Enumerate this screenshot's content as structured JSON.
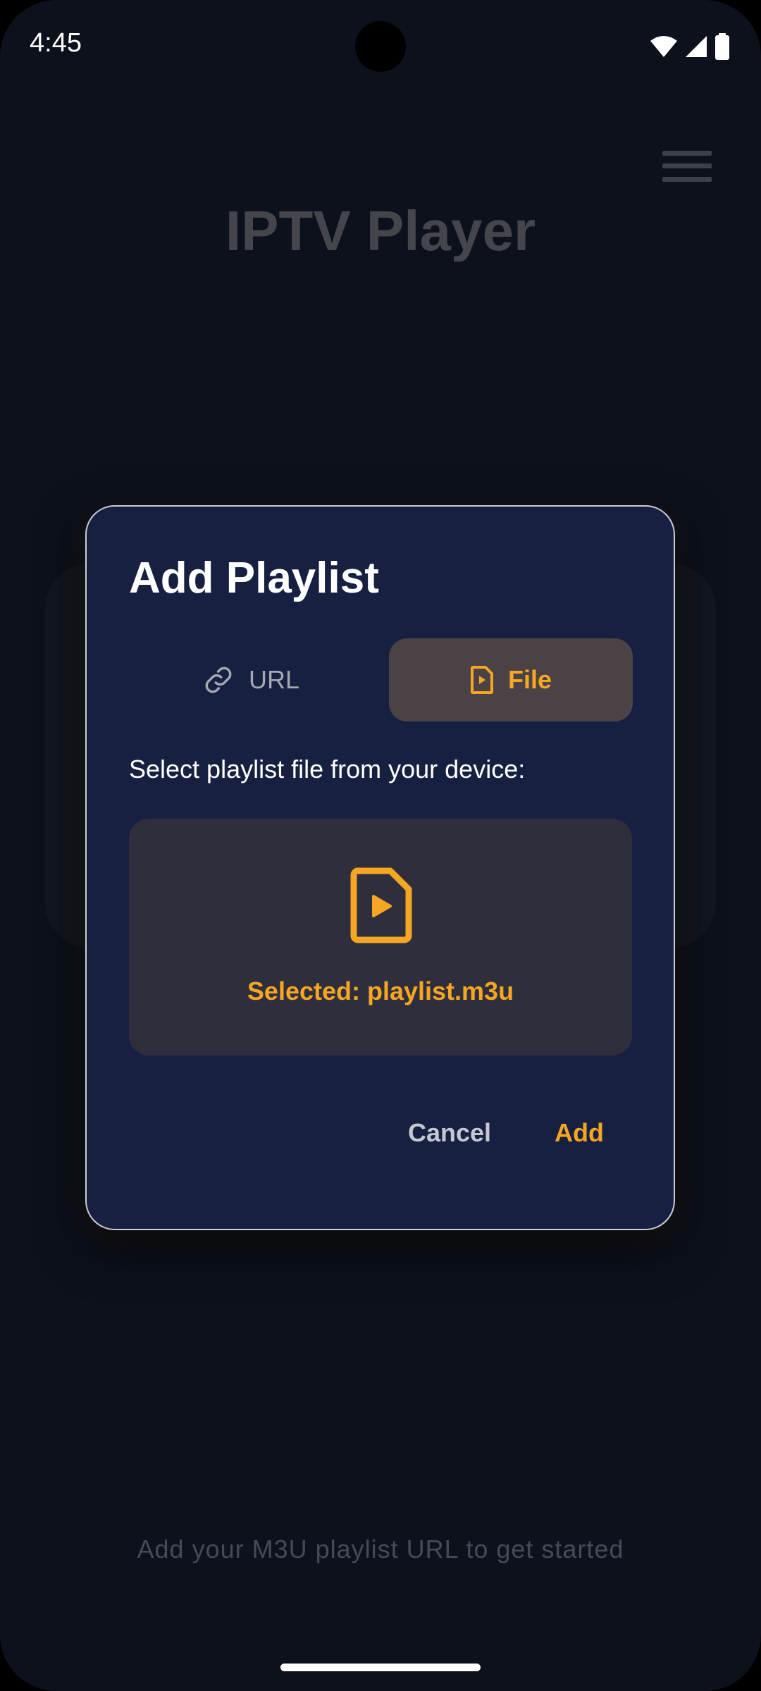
{
  "status_bar": {
    "time": "4:45",
    "icons": [
      "wifi-icon",
      "signal-icon",
      "battery-icon"
    ]
  },
  "app": {
    "title": "IPTV Player",
    "menu_icon": "hamburger-menu-icon",
    "hint": "Add your M3U playlist URL to get started"
  },
  "dialog": {
    "title": "Add Playlist",
    "tabs": [
      {
        "label": "URL",
        "icon": "link-icon",
        "selected": false
      },
      {
        "label": "File",
        "icon": "file-play-icon",
        "selected": true
      }
    ],
    "instruction": "Select playlist file from your device:",
    "file_icon": "file-play-icon",
    "selected_text": "Selected: playlist.m3u",
    "cancel_label": "Cancel",
    "add_label": "Add"
  },
  "colors": {
    "accent": "#f5a623",
    "dialog_bg": "#172040",
    "background": "#0d111c",
    "file_box_bg": "#2f2e3d",
    "selected_tab_bg": "#4b4246"
  }
}
